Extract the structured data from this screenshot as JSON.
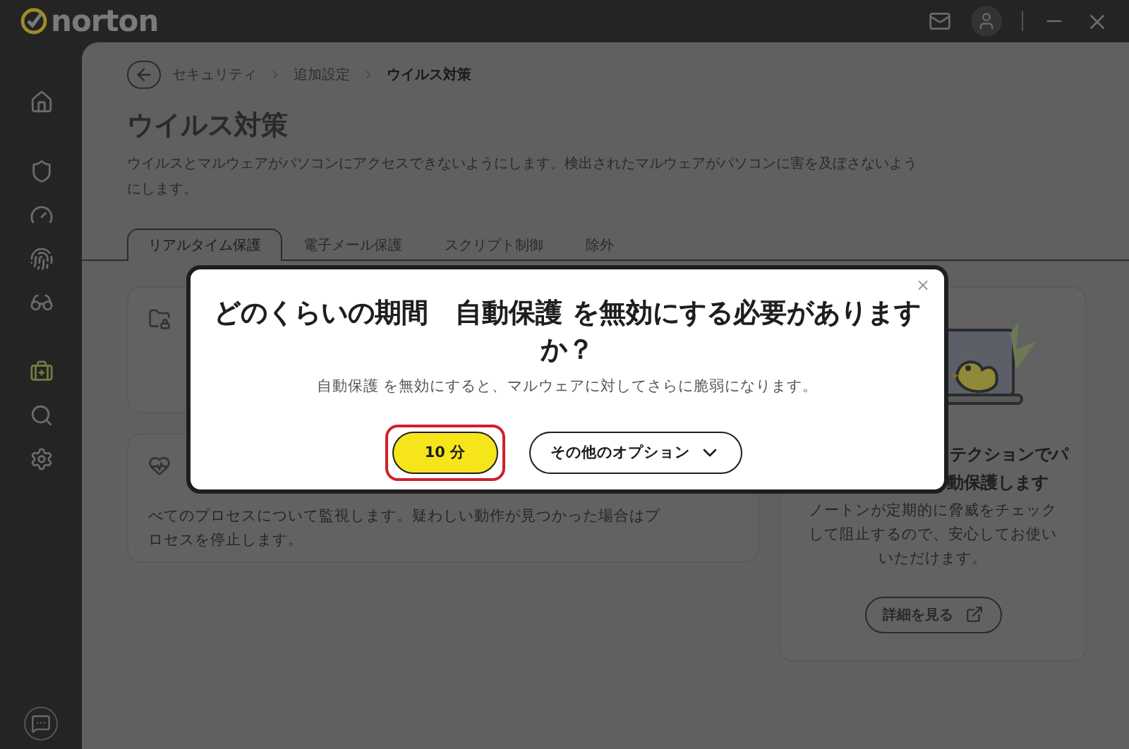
{
  "app": {
    "logo": "norton"
  },
  "breadcrumb": [
    {
      "label": "セキュリティ",
      "current": false
    },
    {
      "label": "追加設定",
      "current": false
    },
    {
      "label": "ウイルス対策",
      "current": true
    }
  ],
  "page": {
    "title": "ウイルス対策",
    "description": "ウイルスとマルウェアがパソコンにアクセスできないようにします。検出されたマルウェアがパソコンに害を及ぼさないようにします。"
  },
  "tabs": [
    {
      "label": "リアルタイム保護",
      "selected": true
    },
    {
      "label": "電子メール保護",
      "selected": false
    },
    {
      "label": "スクリプト制御",
      "selected": false
    },
    {
      "label": "除外",
      "selected": false
    }
  ],
  "cards": [
    {
      "kind": "folder"
    },
    {
      "kind": "process",
      "description": "べてのプロセスについて監視します。疑わしい動作が見つかった場合はプロセスを停止します。"
    }
  ],
  "promo": {
    "title_lines": [
      "テクションでパ",
      "動保護します"
    ],
    "description": "ノートンが定期的に脅威をチェックして阻止するので、安心してお使いいただけます。",
    "button": "詳細を見る"
  },
  "dialog": {
    "title": "どのくらいの期間　自動保護 を無効にする必要がありますか？",
    "message": "自動保護 を無効にすると、マルウェアに対してさらに脆弱になります。",
    "close": "×",
    "buttons": [
      {
        "kind": "primary",
        "label": "10 分",
        "highlighted": true
      },
      {
        "kind": "dropdown",
        "label": "その他のオプション",
        "highlighted": false
      }
    ]
  }
}
